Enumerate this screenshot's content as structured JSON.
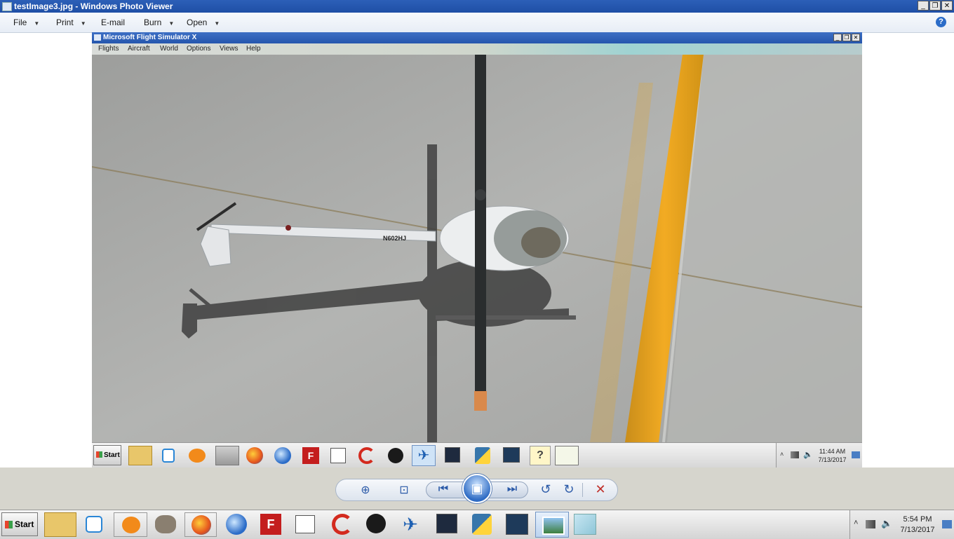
{
  "outer_window": {
    "title": "testImage3.jpg - Windows Photo Viewer",
    "controls": {
      "minimize": "_",
      "restore": "❐",
      "close": "✕"
    },
    "menu": [
      {
        "label": "File"
      },
      {
        "label": "Print"
      },
      {
        "label": "E-mail"
      },
      {
        "label": "Burn"
      },
      {
        "label": "Open"
      }
    ],
    "help_label": "?"
  },
  "fsx_window": {
    "title": "Microsoft Flight Simulator X",
    "controls": {
      "minimize": "_",
      "restore": "❐",
      "close": "✕"
    },
    "menu": [
      {
        "label": "Flights"
      },
      {
        "label": "Aircraft"
      },
      {
        "label": "World"
      },
      {
        "label": "Options"
      },
      {
        "label": "Views"
      },
      {
        "label": "Help"
      }
    ],
    "scene": {
      "tail_number": "N602HJ",
      "colors": {
        "ground": "#a9aaa8",
        "taxi_line": "#e8a21c",
        "fuselage": "#e9ebec"
      }
    }
  },
  "inner_taskbar": {
    "start_label": "Start",
    "icons": [
      "explorer-icon",
      "media-player-icon",
      "blender-icon",
      "gimp-icon",
      "firefox-icon",
      "thunderbird-icon",
      "filezilla-icon",
      "notepad-icon",
      "ccleaner-icon",
      "obs-icon",
      "flight-simulator-icon",
      "unity-icon",
      "python-icon",
      "python-shell-icon",
      "help-file-icon",
      "chart-icon"
    ],
    "time": "11:44 AM",
    "date": "7/13/2017"
  },
  "viewer_controls": {
    "zoom": "⊕",
    "fit": "⊡",
    "previous": "⏮",
    "slideshow": "▣",
    "next": "⏭",
    "rotate_ccw": "↺",
    "rotate_cw": "↻",
    "delete": "✕"
  },
  "outer_taskbar": {
    "start_label": "Start",
    "icons": [
      "explorer-icon",
      "media-player-icon",
      "blender-icon",
      "gimp-icon",
      "firefox-icon",
      "thunderbird-icon",
      "filezilla-icon",
      "notepad-icon",
      "ccleaner-icon",
      "obs-icon",
      "flight-simulator-icon",
      "unity-icon",
      "python-icon",
      "python-shell-icon",
      "photo-viewer-icon",
      "notepad-pad-icon"
    ],
    "time": "5:54 PM",
    "date": "7/13/2017"
  }
}
